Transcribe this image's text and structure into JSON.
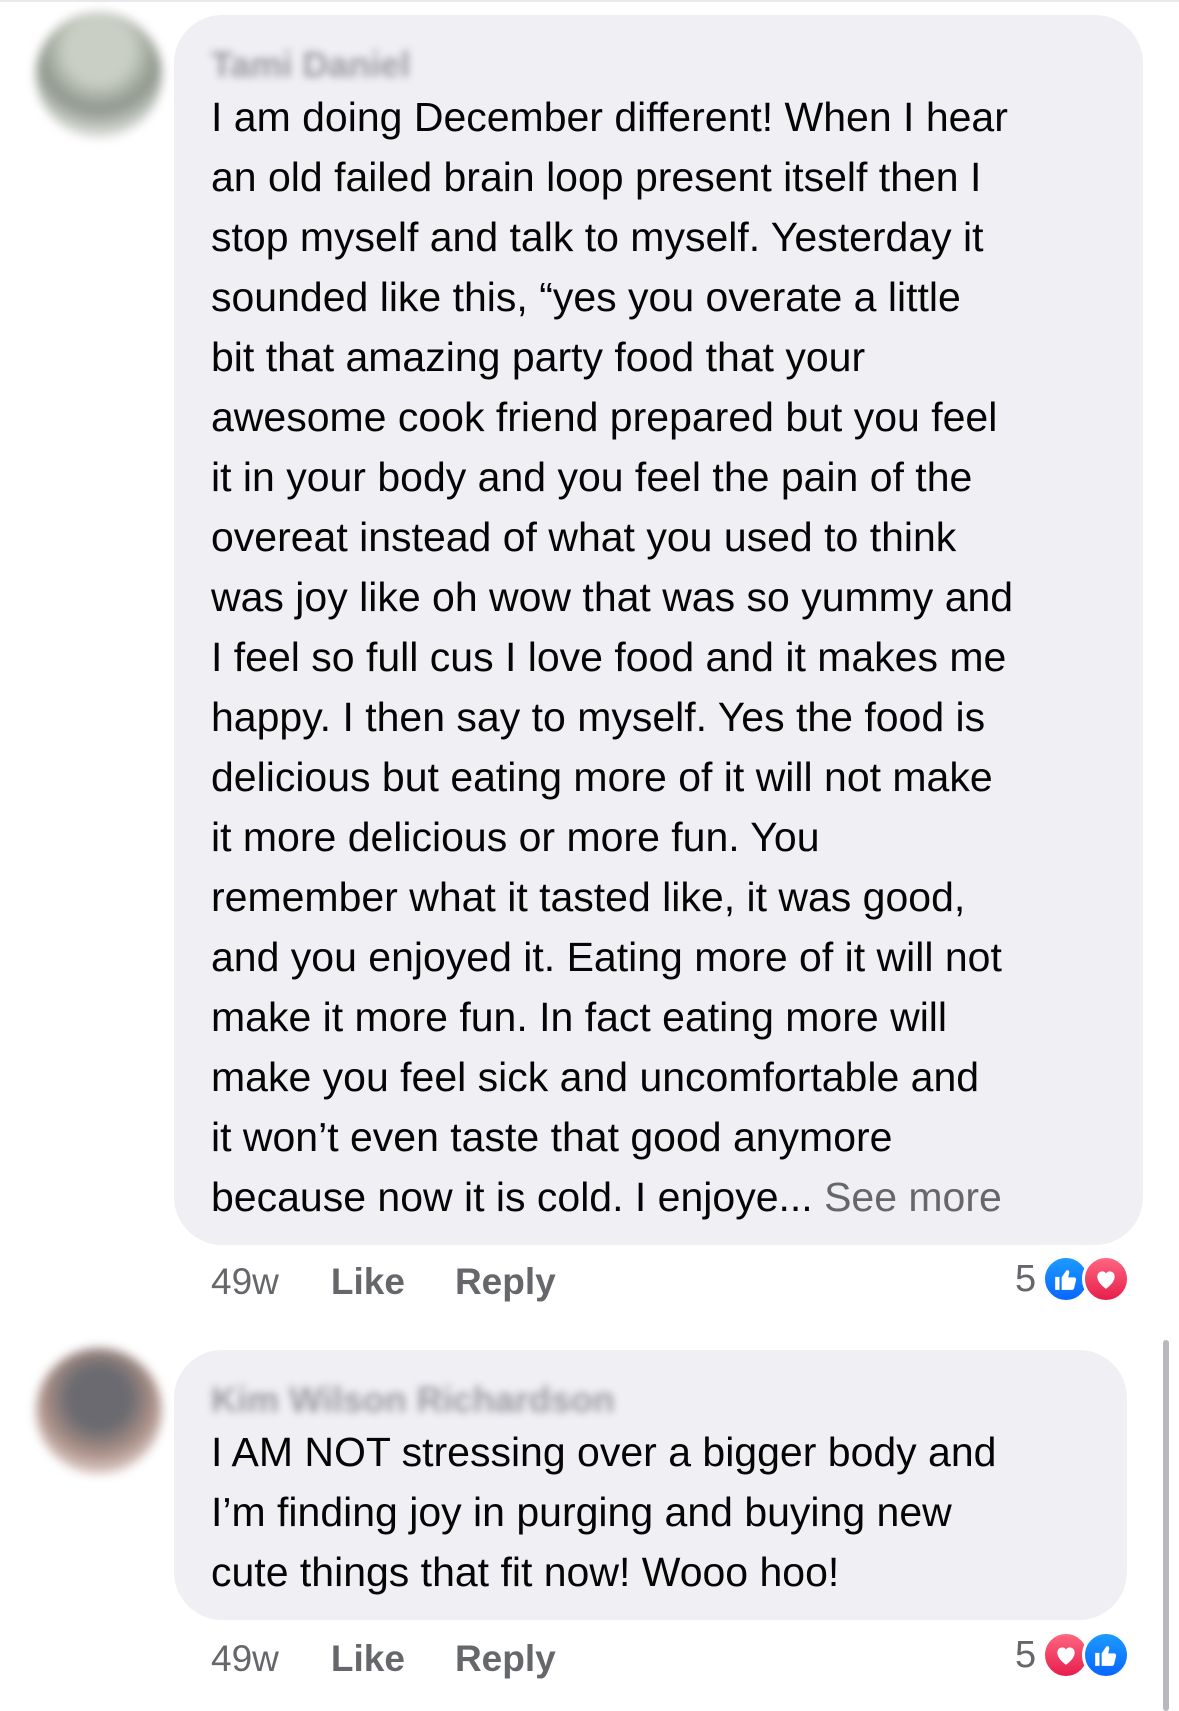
{
  "comments": [
    {
      "author": "Tami Daniel",
      "text": "I am doing December different! When I hear\nan old failed brain loop present itself then I\nstop myself and talk to myself. Yesterday it\nsounded like this, “yes you overate a little\nbit that amazing party food that your\nawesome cook friend prepared but you feel\nit in your body and you feel the pain of the\novereat instead of what you used to think\nwas joy like oh wow that was so yummy and\nI feel so full cus I love food and it makes me\nhappy. I then say to myself. Yes the food is\ndelicious but eating more of it will not make\nit more delicious or more fun. You\nremember what it tasted like, it was good,\nand you enjoyed it. Eating more of it will not\nmake it more fun. In fact eating more will\nmake you feel sick and uncomfortable and\nit won’t even taste that good anymore\nbecause now it is cold. I enjoye... ",
      "see_more": "See more",
      "time": "49w",
      "like_label": "Like",
      "reply_label": "Reply",
      "reaction_count": "5",
      "reactions": [
        "like-icon",
        "love-icon"
      ]
    },
    {
      "author": "Kim Wilson Richardson",
      "text": "I AM NOT stressing over a bigger body and\nI’m finding joy in purging and buying new\ncute things that fit now!  Wooo hoo!",
      "time": "49w",
      "like_label": "Like",
      "reply_label": "Reply",
      "reaction_count": "5",
      "reactions": [
        "love-icon",
        "like-icon"
      ]
    }
  ],
  "colors": {
    "bubble": "#f0f0f4",
    "meta_text": "#65676b",
    "like_blue": "#0866ff",
    "love_red": "#e61e4d"
  }
}
